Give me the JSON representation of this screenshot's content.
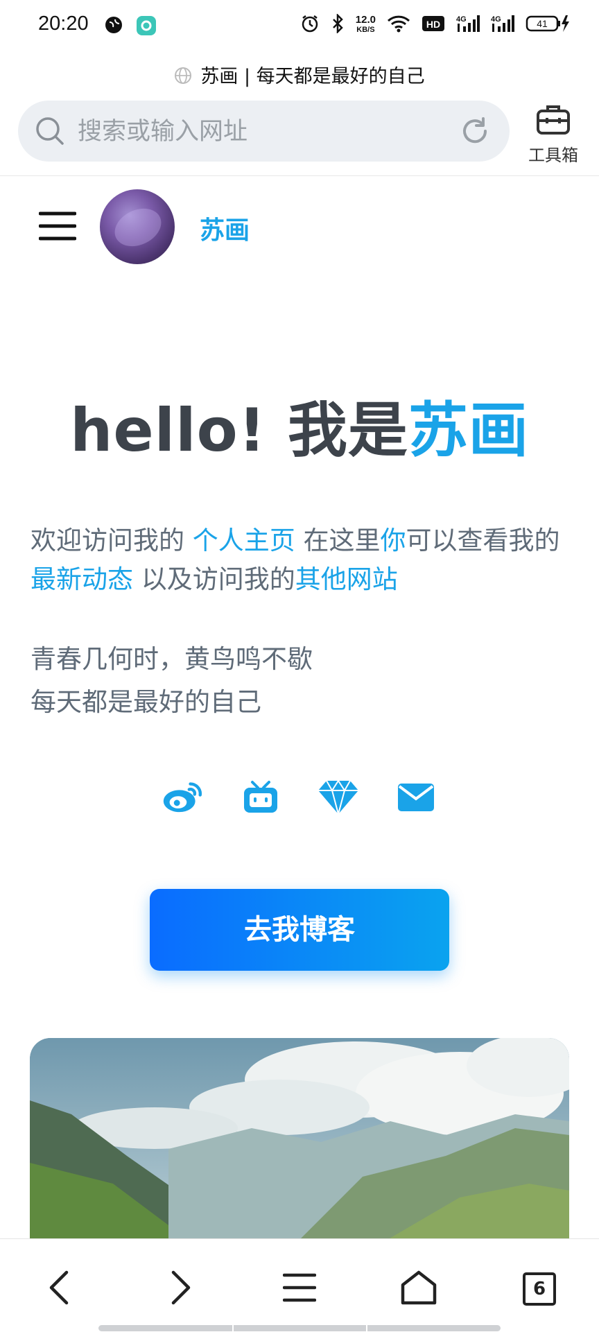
{
  "status_bar": {
    "time": "20:20",
    "net_speed_value": "12.0",
    "net_speed_unit": "KB/S",
    "hd_badge": "HD",
    "signal_1": "4G",
    "signal_2": "4G",
    "battery": "41"
  },
  "browser": {
    "page_title": "苏画 | 每天都是最好的自己",
    "search_placeholder": "搜索或输入网址",
    "toolbox_label": "工具箱",
    "tab_count": "6"
  },
  "site": {
    "name": "苏画",
    "hello_prefix": "hello! 我是",
    "hello_name": "苏画",
    "intro": {
      "t1": "欢迎访问我的 ",
      "l1": "个人主页",
      "t2": " 在这里",
      "l2": "你",
      "t3": "可以查看我的",
      "l3": "最新动态",
      "t4": " 以及访问我的",
      "l4": "其他网站"
    },
    "motto_line1": "青春几何时，黄鸟鸣不歇",
    "motto_line2": "每天都是最好的自己",
    "blog_button": "去我博客",
    "social_icons": [
      "weibo-icon",
      "bilibili-icon",
      "diamond-icon",
      "mail-icon"
    ]
  },
  "colors": {
    "accent": "#1aa3e8",
    "text": "#5f6b78",
    "heading": "#3d434b",
    "button_gradient_start": "#0a6cff",
    "button_gradient_end": "#0aa3ef"
  }
}
